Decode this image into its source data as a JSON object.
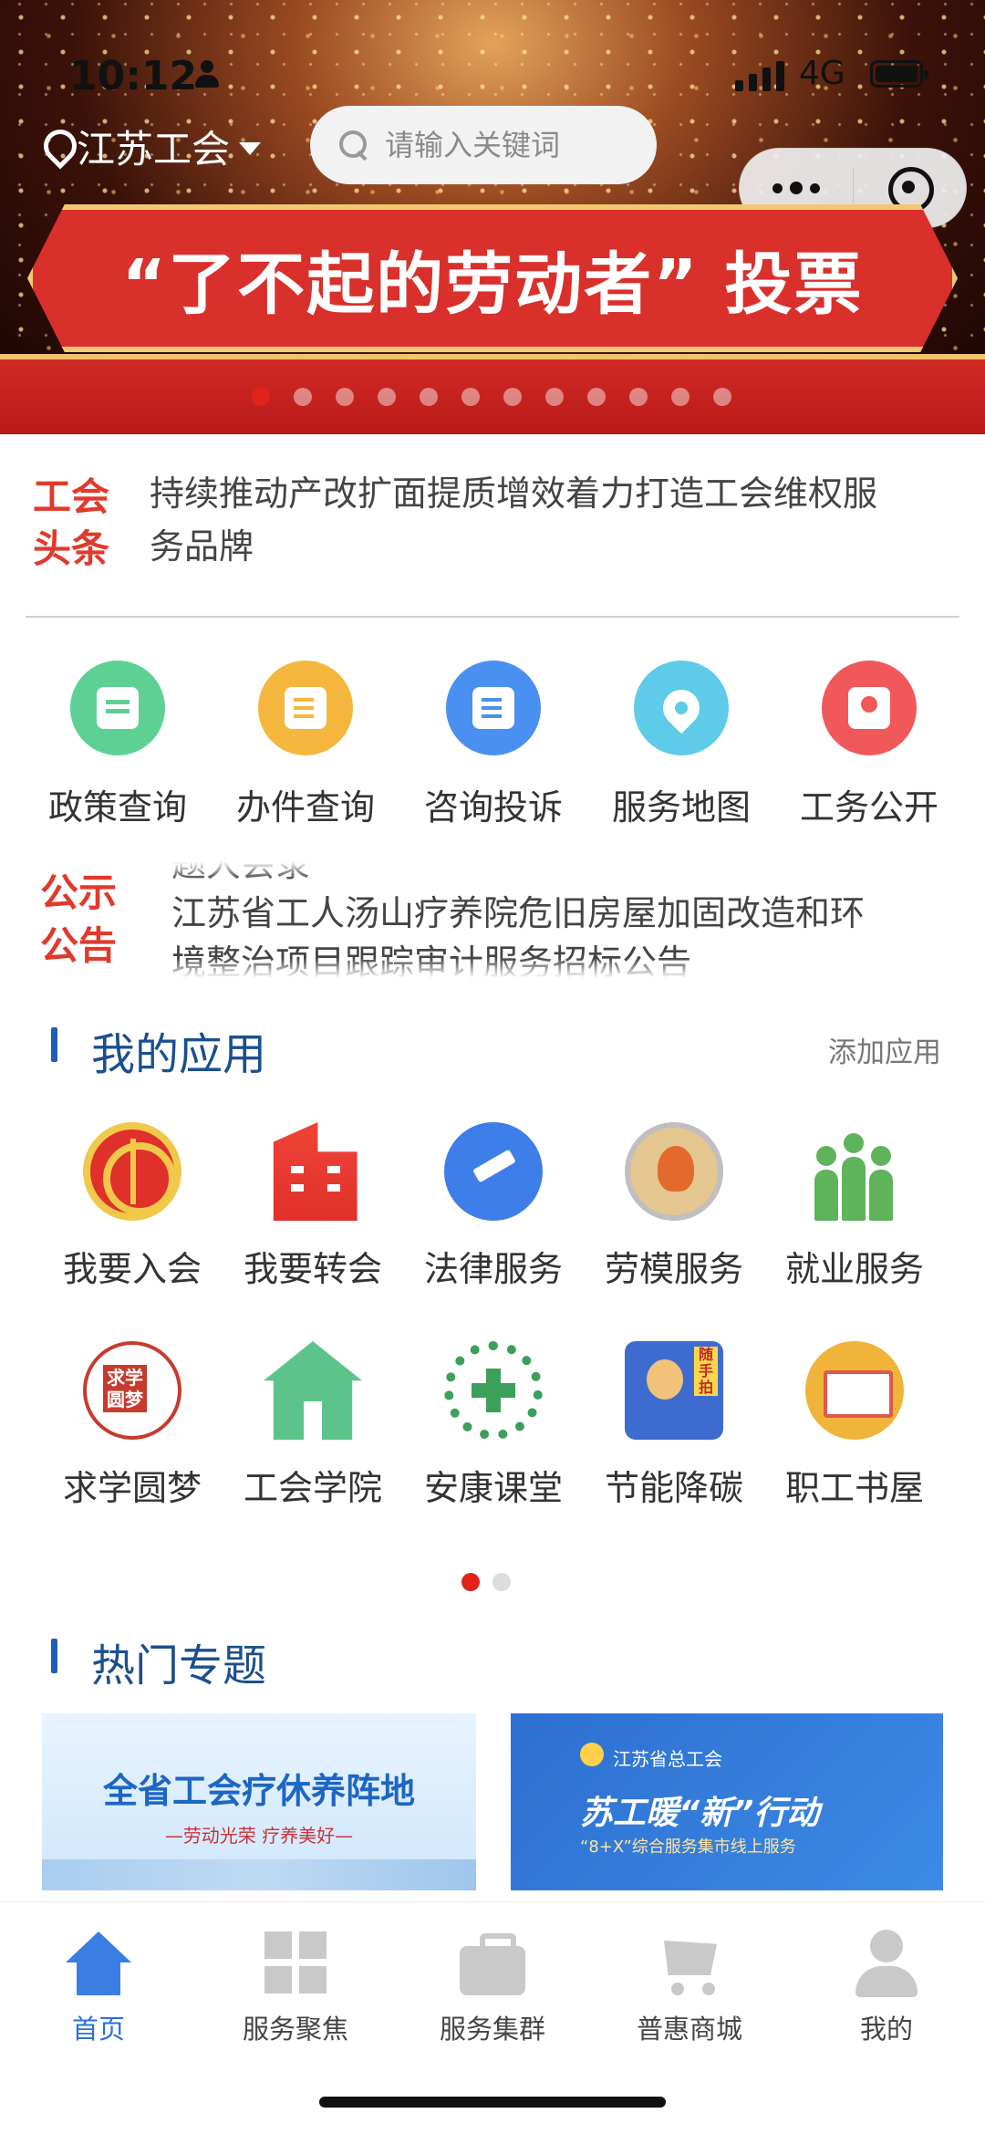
{
  "status": {
    "time": "10:12",
    "network": "4G"
  },
  "header": {
    "location": "江苏工会",
    "search_placeholder": "请输入关键词"
  },
  "banner": {
    "title": "“了不起的劳动者” 投票",
    "slide_count": 12,
    "active_slide": 0
  },
  "headline": {
    "tag": "工会头条",
    "text": "持续推动产改扩面提质增效着力打造工会维权服务品牌"
  },
  "quick_services": [
    {
      "label": "政策查询",
      "icon": "chat-list-icon",
      "color": "#5cd193"
    },
    {
      "label": "办件查询",
      "icon": "document-search-icon",
      "color": "#f5b63e"
    },
    {
      "label": "咨询投诉",
      "icon": "document-edit-icon",
      "color": "#4a90f0"
    },
    {
      "label": "服务地图",
      "icon": "map-pin-icon",
      "color": "#5ecbe8"
    },
    {
      "label": "工务公开",
      "icon": "public-document-icon",
      "color": "#f1585a"
    }
  ],
  "notice": {
    "tag": "公示公告",
    "prev_line": "题大会录",
    "line1": "江苏省工人汤山疗养院危旧房屋加固改造和环",
    "line2": "境整治项目跟踪审计服务招标公告"
  },
  "my_apps": {
    "title": "我的应用",
    "add_label": "添加应用",
    "items": [
      {
        "label": "我要入会",
        "icon": "union-emblem-icon"
      },
      {
        "label": "我要转会",
        "icon": "building-icon"
      },
      {
        "label": "法律服务",
        "icon": "gavel-icon"
      },
      {
        "label": "劳模服务",
        "icon": "model-worker-icon"
      },
      {
        "label": "就业服务",
        "icon": "people-group-icon"
      },
      {
        "label": "求学圆梦",
        "icon": "study-dream-icon"
      },
      {
        "label": "工会学院",
        "icon": "academy-icon"
      },
      {
        "label": "安康课堂",
        "icon": "health-cross-icon"
      },
      {
        "label": "节能降碳",
        "icon": "photo-report-icon"
      },
      {
        "label": "职工书屋",
        "icon": "open-book-icon"
      }
    ],
    "page_count": 2,
    "active_page": 0
  },
  "hot_topics": {
    "title": "热门专题",
    "items": [
      {
        "title": "全省工会疗休养阵地",
        "subtitle": "—劳动光荣  疗养美好—"
      },
      {
        "org": "江苏省总工会",
        "title": "苏工暖“新”行动",
        "subtitle": "“8+X”综合服务集市线上服务"
      }
    ]
  },
  "tabbar": {
    "items": [
      {
        "label": "首页",
        "icon": "home-icon",
        "active": true
      },
      {
        "label": "服务聚焦",
        "icon": "grid-icon",
        "active": false
      },
      {
        "label": "服务集群",
        "icon": "briefcase-icon",
        "active": false
      },
      {
        "label": "普惠商城",
        "icon": "cart-icon",
        "active": false
      },
      {
        "label": "我的",
        "icon": "user-icon",
        "active": false
      }
    ]
  },
  "colors": {
    "accent_red": "#e03a2c",
    "section_blue": "#1b4f8f",
    "tab_active": "#2b6fd6"
  }
}
